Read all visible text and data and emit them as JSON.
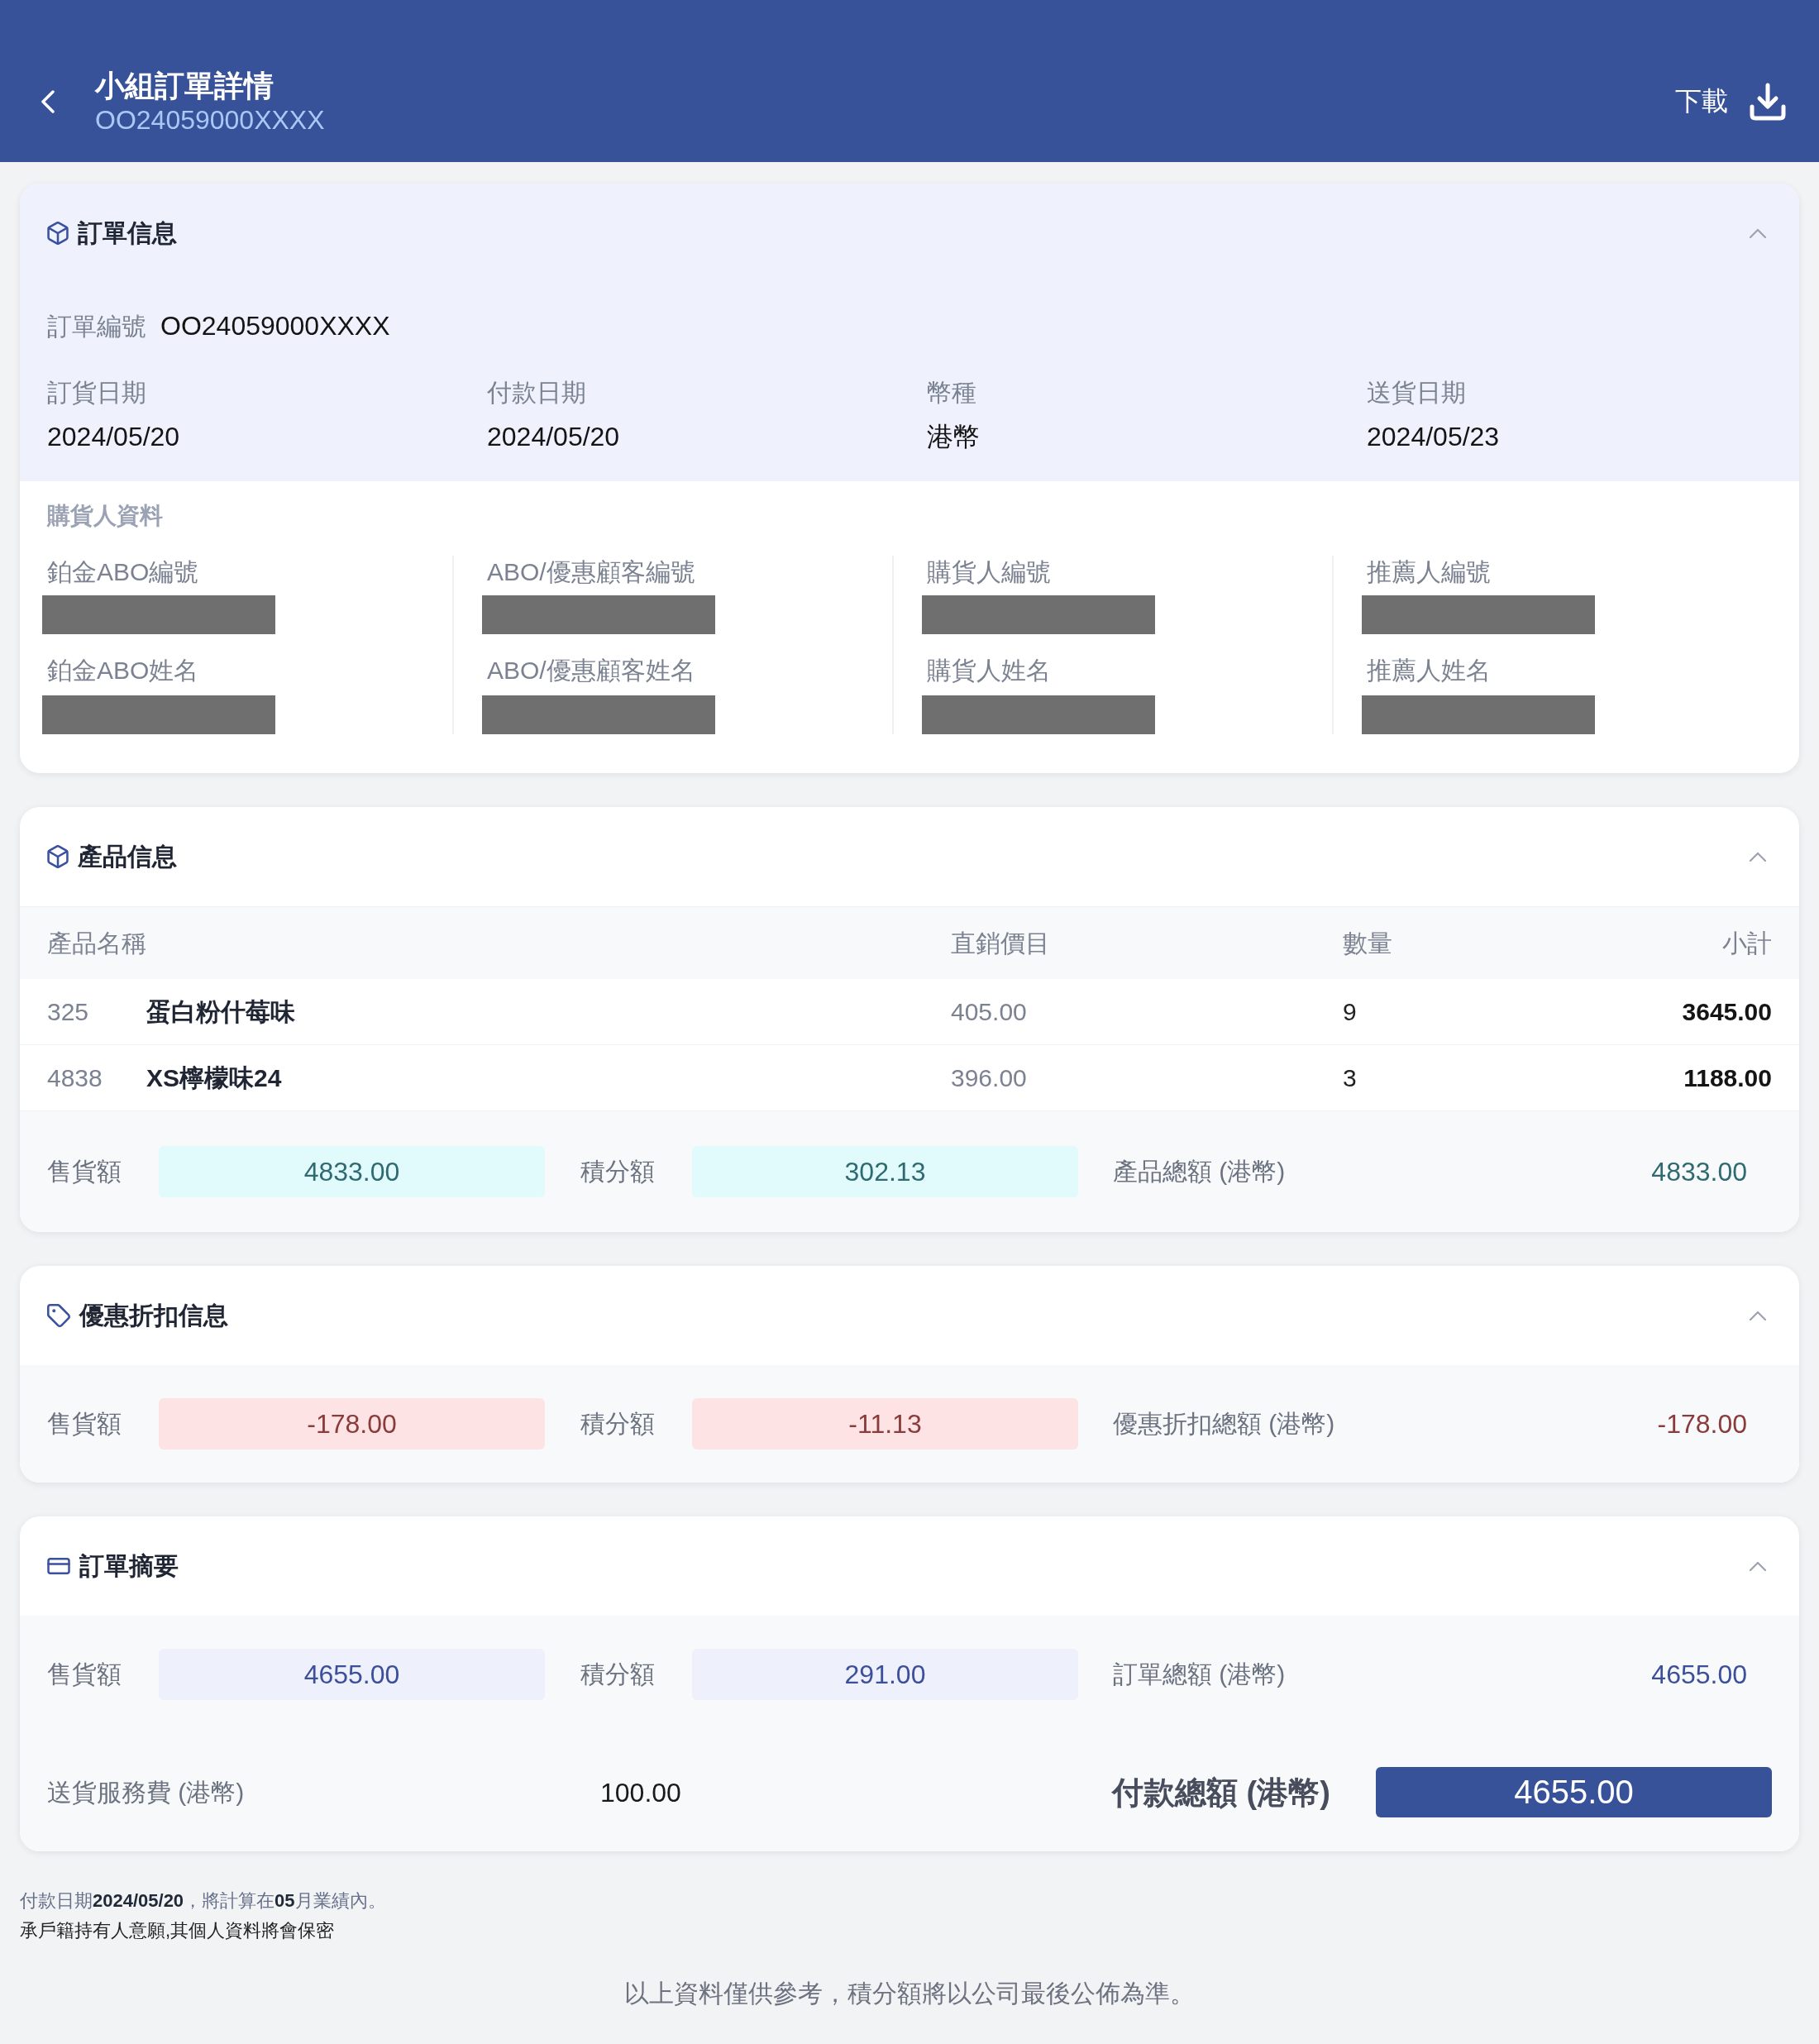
{
  "header": {
    "title": "小組訂單詳情",
    "order_number": "OO24059000XXXX",
    "download_label": "下載"
  },
  "order_info": {
    "title": "訂單信息",
    "expanded": true,
    "order_number_label": "訂單編號",
    "order_number": "OO24059000XXXX",
    "dates": [
      {
        "label": "訂貨日期",
        "value": "2024/05/20"
      },
      {
        "label": "付款日期",
        "value": "2024/05/20"
      },
      {
        "label": "幣種",
        "value": "港幣"
      },
      {
        "label": "送貨日期",
        "value": "2024/05/23"
      }
    ],
    "buyer_info": {
      "title": "購貨人資料",
      "columns": [
        [
          "鉑金ABO編號",
          "鉑金ABO姓名"
        ],
        [
          "ABO/優惠顧客編號",
          "ABO/優惠顧客姓名"
        ],
        [
          "購貨人編號",
          "購貨人姓名"
        ],
        [
          "推薦人編號",
          "推薦人姓名"
        ]
      ]
    }
  },
  "product_info": {
    "title": "產品信息",
    "expanded": true,
    "columns": [
      "產品名稱",
      "直銷價目",
      "數量",
      "小計"
    ],
    "rows": [
      {
        "code": "325",
        "name": "蛋白粉什莓味",
        "price": "405.00",
        "quantity": "9",
        "subtotal": "3645.00"
      },
      {
        "code": "4838",
        "name": "XS檸檬味24",
        "price": "396.00",
        "quantity": "3",
        "subtotal": "1188.00"
      }
    ],
    "amounts": [
      {
        "label": "售貨額",
        "value": "4833.00"
      },
      {
        "label": "積分額",
        "value": "302.13"
      }
    ],
    "total_label": "產品總額 (港幣)",
    "total_value": "4833.00"
  },
  "discount_info": {
    "title": "優惠折扣信息",
    "expanded": true,
    "amounts": [
      {
        "label": "售貨額",
        "value": "-178.00"
      },
      {
        "label": "積分額",
        "value": "-11.13"
      }
    ],
    "total_label": "優惠折扣總額 (港幣)",
    "total_value": "-178.00"
  },
  "order_summary": {
    "title": "訂單摘要",
    "expanded": true,
    "amounts": [
      {
        "label": "售貨額",
        "value": "4655.00"
      },
      {
        "label": "積分額",
        "value": "291.00"
      }
    ],
    "total_label": "訂單總額 (港幣)",
    "total_value": "4655.00",
    "delivery_fee_label": "送貨服務費 (港幣)",
    "delivery_fee": "100.00",
    "payment_total_label": "付款總額 (港幣)",
    "payment_total": "4655.00"
  },
  "footnotes": [
    "付款日期**2024/05/20**，將計算在**05**月業績內。",
    "承戶籍持有人意願,其個人資料將會保密"
  ],
  "disclaimer": "以上資料僅供參考，積分額將以公司最後公佈為準。"
}
